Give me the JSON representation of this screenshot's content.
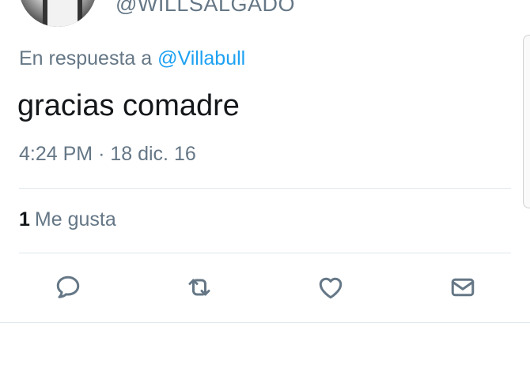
{
  "tweet": {
    "handle": "@WILLSALGADO",
    "reply_prefix": "En respuesta a",
    "reply_mention": "@Villabull",
    "text": "gracias comadre",
    "time": "4:24 PM",
    "separator": "·",
    "date": "18 dic. 16",
    "likes_count": "1",
    "likes_label": "Me gusta"
  },
  "actions": [
    {
      "name": "reply",
      "icon": "speech-bubble-icon"
    },
    {
      "name": "retweet",
      "icon": "retweet-icon"
    },
    {
      "name": "like",
      "icon": "heart-icon"
    },
    {
      "name": "message",
      "icon": "envelope-icon"
    }
  ],
  "colors": {
    "text": "#14171a",
    "secondary": "#657786",
    "link": "#1da1f2",
    "divider": "#e1e8ed"
  }
}
